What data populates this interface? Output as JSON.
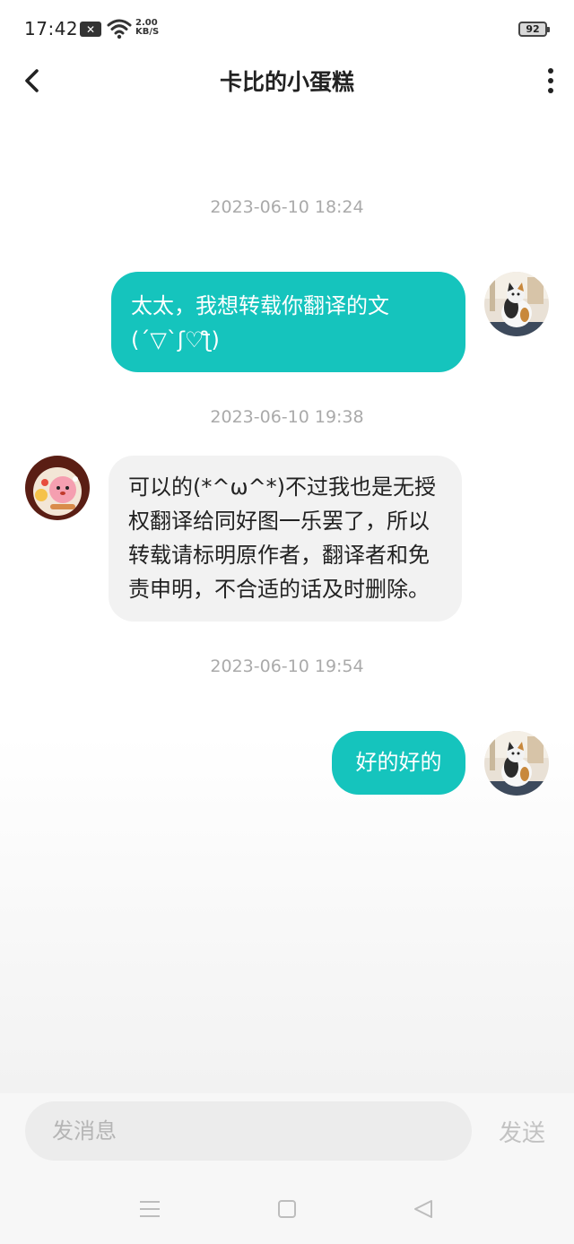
{
  "status_bar": {
    "time": "17:42",
    "notification_icon": "close-box-icon",
    "wifi_icon": "wifi-icon",
    "speed_value": "2.00",
    "speed_unit": "KB/S",
    "battery_level": "92"
  },
  "header": {
    "back_icon": "chevron-left-icon",
    "title": "卡比的小蛋糕",
    "more_icon": "more-vertical-icon"
  },
  "messages": [
    {
      "timestamp": "2023-06-10 18:24",
      "direction": "sent",
      "line1": "太太，我想转载你翻译的文",
      "line2": "(´▽`ʃ♡ƪ)"
    },
    {
      "timestamp": "2023-06-10 19:38",
      "direction": "received",
      "line1": "可以的(*^ω^*)不过我也是无授",
      "line2": "权翻译给同好图一乐罢了，所以",
      "line3": "转载请标明原作者，翻译者和免",
      "line4": "责申明，不合适的话及时删除。"
    },
    {
      "timestamp": "2023-06-10 19:54",
      "direction": "sent",
      "line1": "好的好的"
    }
  ],
  "input": {
    "placeholder": "发消息",
    "send_label": "发送"
  },
  "system_nav": {
    "menu_icon": "menu-icon",
    "home_icon": "square-home-icon",
    "back_icon": "triangle-back-icon"
  },
  "colors": {
    "sent_bubble": "#15c4bd",
    "received_bubble": "#f2f2f2",
    "timestamp_text": "#aaaaaa"
  }
}
